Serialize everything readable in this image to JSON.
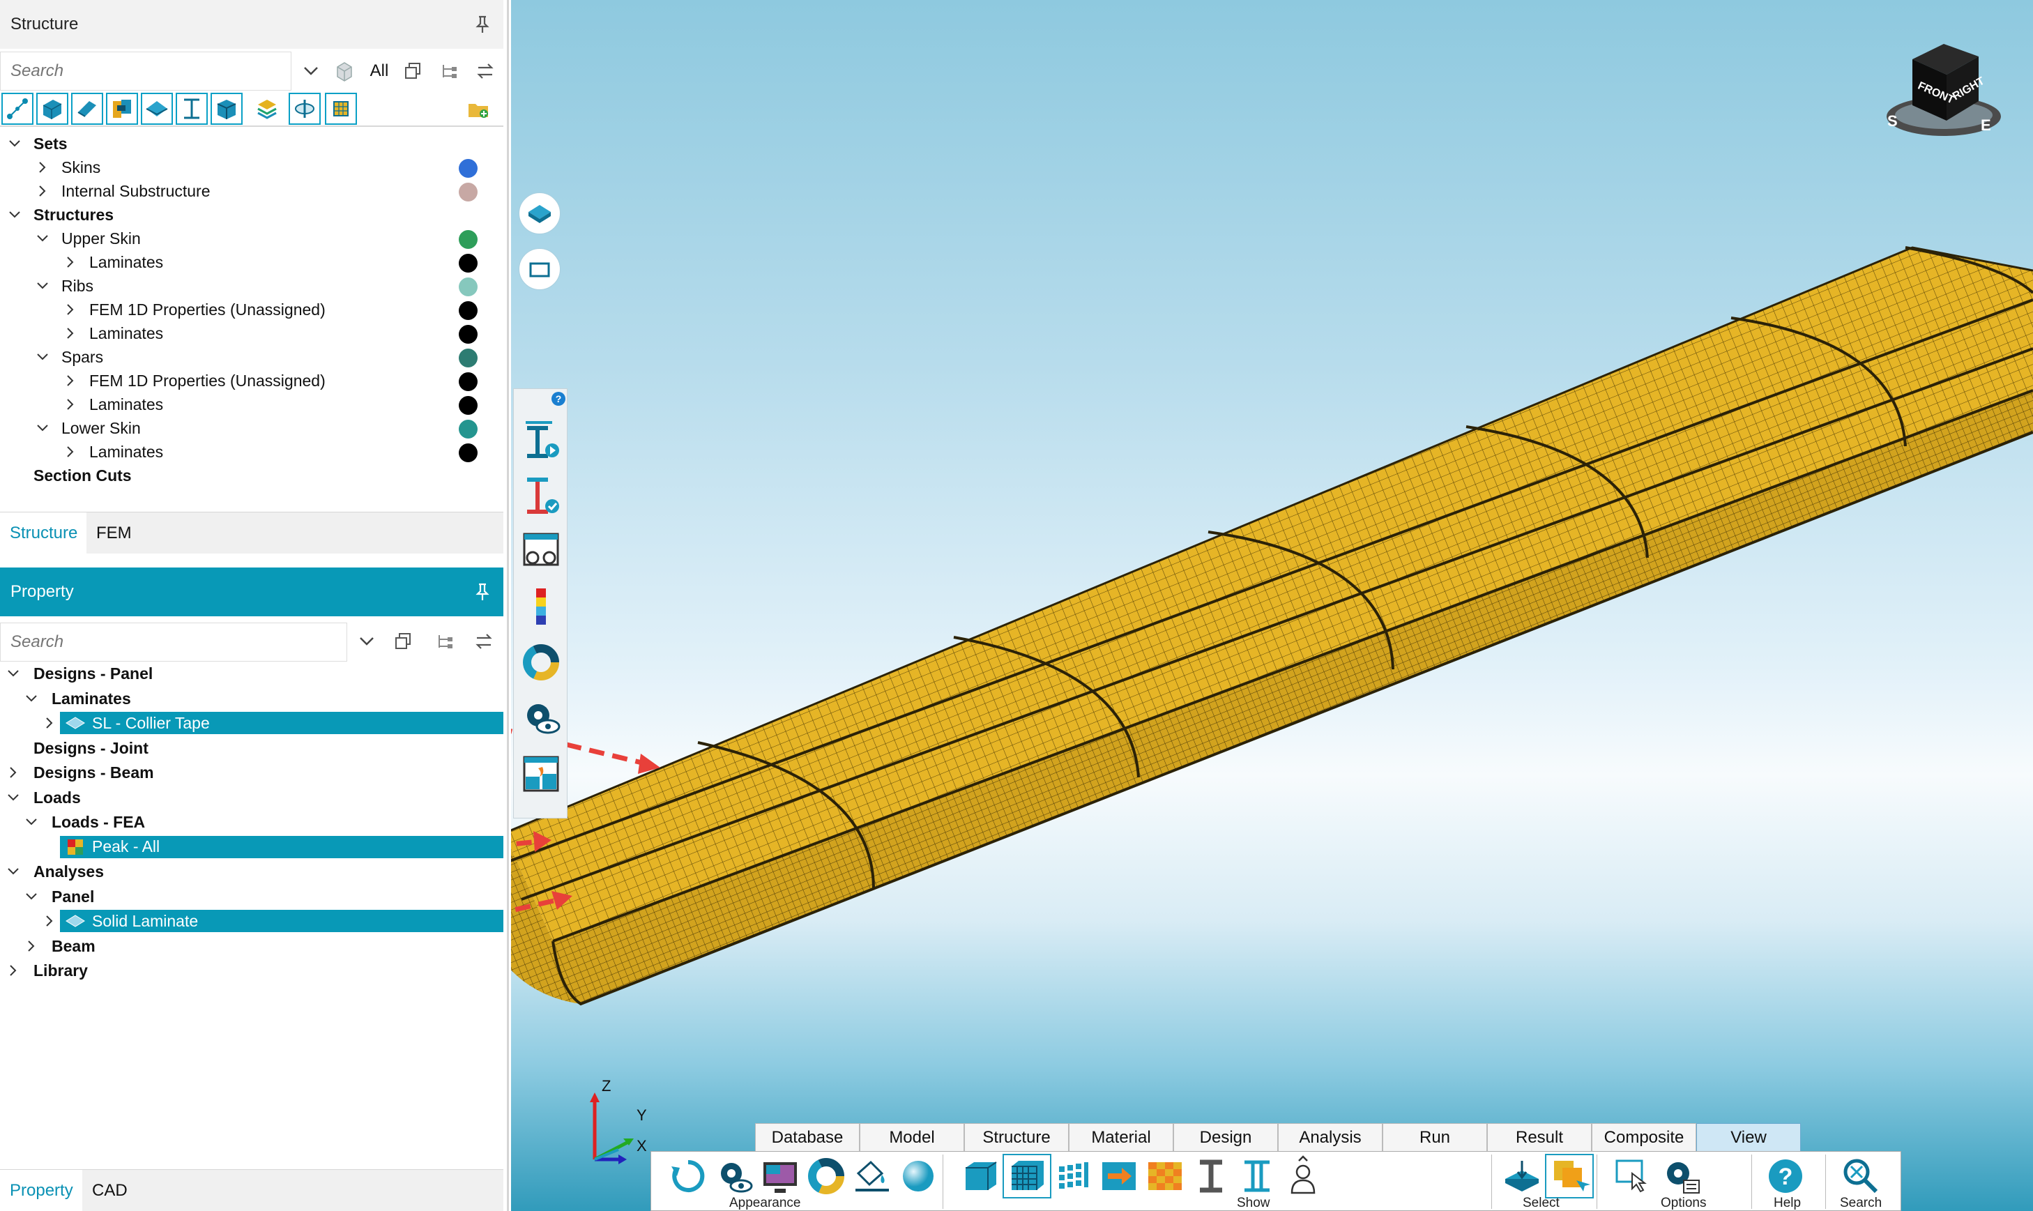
{
  "structure_panel": {
    "title": "Structure",
    "search_placeholder": "Search",
    "filter_value": "All",
    "toolbar_icons": [
      "node-icon",
      "solid-icon",
      "plate-icon",
      "joint-icon",
      "panel-icon",
      "beam-icon",
      "box-icon",
      "layers-icon",
      "section-icon",
      "fem-icon"
    ],
    "tree": [
      {
        "label": "Sets",
        "bold": true
      },
      {
        "label": "Skins",
        "color": "#2f6fd8"
      },
      {
        "label": "Internal Substructure",
        "color": "#c7a8a4"
      },
      {
        "label": "Structures",
        "bold": true
      },
      {
        "label": "Upper Skin",
        "color": "#2e9e5a"
      },
      {
        "label": "Laminates",
        "color": "#000000"
      },
      {
        "label": "Ribs",
        "color": "#86c8bd"
      },
      {
        "label": "FEM 1D Properties (Unassigned)",
        "color": "#000000"
      },
      {
        "label": "Laminates",
        "color": "#000000"
      },
      {
        "label": "Spars",
        "color": "#2d7c72"
      },
      {
        "label": "FEM 1D Properties (Unassigned)",
        "color": "#000000"
      },
      {
        "label": "Laminates",
        "color": "#000000"
      },
      {
        "label": "Lower Skin",
        "color": "#24958f"
      },
      {
        "label": "Laminates",
        "color": "#000000"
      },
      {
        "label": "Section Cuts",
        "bold": true
      }
    ],
    "tabs": [
      "Structure",
      "FEM"
    ]
  },
  "property_panel": {
    "title": "Property",
    "search_placeholder": "Search",
    "tree": [
      {
        "label": "Designs - Panel",
        "bold": true
      },
      {
        "label": "Laminates",
        "bold": true
      },
      {
        "label": "SL - Collier Tape"
      },
      {
        "label": "Designs - Joint",
        "bold": true
      },
      {
        "label": "Designs - Beam",
        "bold": true
      },
      {
        "label": "Loads",
        "bold": true
      },
      {
        "label": "Loads - FEA",
        "bold": true
      },
      {
        "label": "Peak - All"
      },
      {
        "label": "Analyses",
        "bold": true
      },
      {
        "label": "Panel",
        "bold": true
      },
      {
        "label": "Solid Laminate"
      },
      {
        "label": "Beam",
        "bold": true
      },
      {
        "label": "Library",
        "bold": true
      }
    ],
    "tabs": [
      "Property",
      "CAD"
    ]
  },
  "viewport": {
    "view_cube": {
      "faces": [
        "FRONT",
        "RIGHT"
      ],
      "compass": [
        "S",
        "E"
      ]
    },
    "axis_triad": [
      "Z",
      "Y",
      "X"
    ]
  },
  "ribbon": {
    "tabs": [
      "Database",
      "Model",
      "Structure",
      "Material",
      "Design",
      "Analysis",
      "Run",
      "Result",
      "Composite",
      "View"
    ],
    "active_tab": "View",
    "groups": [
      {
        "label": "Appearance",
        "icons": [
          "refresh-icon",
          "settings-eye-icon",
          "display-icon",
          "color-wheel-icon",
          "paint-bucket-icon",
          "sphere-icon"
        ]
      },
      {
        "label": "Show",
        "icons": [
          "panel-show-icon",
          "grid-show-icon",
          "mesh-show-icon",
          "arrow-show-icon",
          "checker-show-icon",
          "beam-show-icon",
          "section-show-icon",
          "person-show-icon"
        ]
      },
      {
        "label": "Select",
        "icons": [
          "select-panel-icon",
          "select-group-icon"
        ]
      },
      {
        "label": "Options",
        "icons": [
          "click-options-icon",
          "settings-options-icon"
        ]
      },
      {
        "label": "Help",
        "icons": [
          "help-icon"
        ]
      },
      {
        "label": "Search",
        "icons": [
          "zoom-search-icon"
        ]
      }
    ]
  },
  "colors": {
    "accent": "#0899b7",
    "mesh": "#e6b526",
    "arrow": "#e8403a"
  }
}
